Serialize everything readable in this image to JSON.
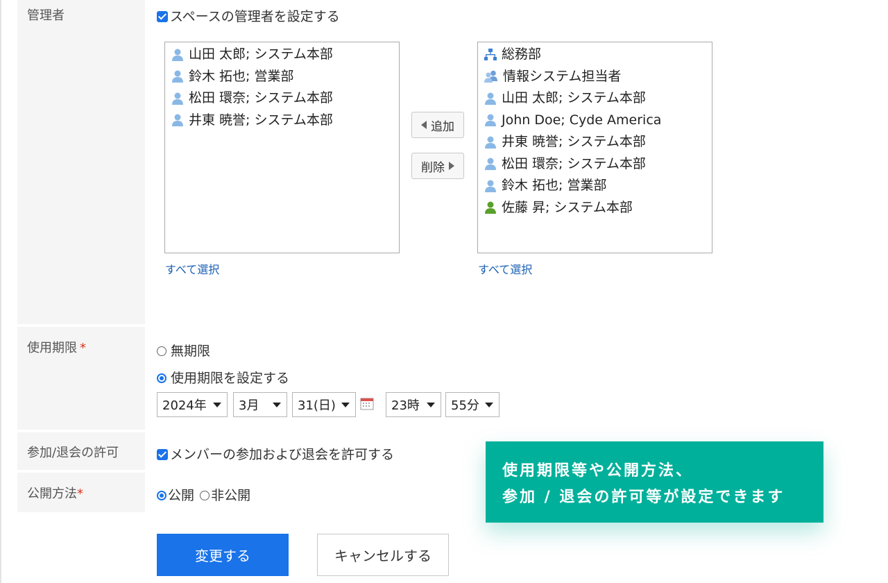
{
  "admin": {
    "label": "管理者",
    "checkbox_label": "スペースの管理者を設定する",
    "selected_list": [
      {
        "icon": "user-icon",
        "text": "山田 太郎; システム本部"
      },
      {
        "icon": "user-icon",
        "text": "鈴木 拓也; 営業部"
      },
      {
        "icon": "user-icon",
        "text": "松田 環奈; システム本部"
      },
      {
        "icon": "user-icon",
        "text": "井東 暁誉; システム本部"
      }
    ],
    "candidate_list": [
      {
        "icon": "org-icon",
        "text": "総務部"
      },
      {
        "icon": "group-icon",
        "text": "情報システム担当者"
      },
      {
        "icon": "user-icon",
        "text": "山田 太郎; システム本部"
      },
      {
        "icon": "user-icon",
        "text": "John Doe; Cyde America"
      },
      {
        "icon": "user-icon",
        "text": "井東 暁誉; システム本部"
      },
      {
        "icon": "user-icon",
        "text": "松田 環奈; システム本部"
      },
      {
        "icon": "user-icon",
        "text": "鈴木 拓也; 営業部"
      },
      {
        "icon": "user-green-icon",
        "text": "佐藤 昇; システム本部"
      }
    ],
    "add_label": "追加",
    "remove_label": "削除",
    "select_all_left": "すべて選択",
    "select_all_right": "すべて選択"
  },
  "expiry": {
    "label": "使用期限",
    "required_mark": "*",
    "option_unlimited": "無期限",
    "option_set": "使用期限を設定する",
    "year": "2024年",
    "month": "3月",
    "day": "31(日)",
    "hour": "23時",
    "minute": "55分"
  },
  "participation": {
    "label": "参加/退会の許可",
    "checkbox_label": "メンバーの参加および退会を許可する"
  },
  "publish": {
    "label": "公開方法",
    "required_mark": "*",
    "option_public": "公開",
    "option_private": "非公開"
  },
  "buttons": {
    "submit": "変更する",
    "cancel": "キャンセルする"
  },
  "callout": {
    "line1": "使用期限等や公開方法、",
    "line2": "参加 / 退会の許可等が設定できます"
  },
  "colors": {
    "accent": "#1a73e8",
    "callout": "#00b09b",
    "link": "#1a5fb4"
  }
}
